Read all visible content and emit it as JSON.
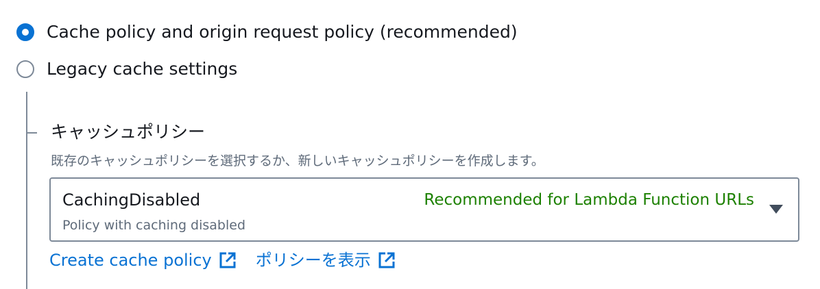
{
  "cache_settings": {
    "options": [
      {
        "label": "Cache policy and origin request policy (recommended)",
        "selected": true
      },
      {
        "label": "Legacy cache settings",
        "selected": false
      }
    ]
  },
  "cache_policy": {
    "label": "キャッシュポリシー",
    "description": "既存のキャッシュポリシーを選択するか、新しいキャッシュポリシーを作成します。",
    "select": {
      "value": "CachingDisabled",
      "tag": "Recommended for Lambda Function URLs",
      "description": "Policy with caching disabled"
    },
    "links": [
      {
        "label": "Create cache policy",
        "icon": "external-link-icon"
      },
      {
        "label": "ポリシーを表示",
        "icon": "external-link-icon"
      }
    ]
  },
  "colors": {
    "accent": "#0972d3",
    "recommended": "#1d8102",
    "text": "#16191f",
    "muted": "#5f6b7a",
    "border": "#7d8998"
  }
}
